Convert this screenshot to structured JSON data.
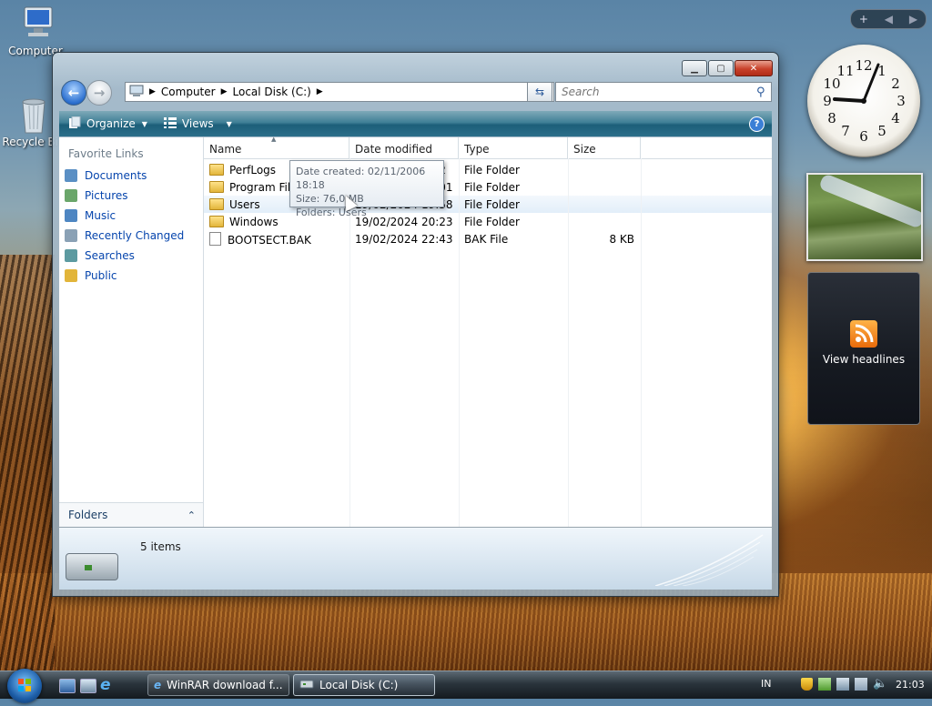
{
  "desktop": {
    "icons": [
      {
        "label": "Computer"
      },
      {
        "label": "Recycle Bin"
      }
    ]
  },
  "sidebar": {
    "controls": [
      "+",
      "◀",
      "▶"
    ],
    "clock": {
      "numbers": [
        "12",
        "1",
        "2",
        "3",
        "4",
        "5",
        "6",
        "7",
        "8",
        "9",
        "10",
        "11"
      ],
      "time": "21:03"
    },
    "feeds": {
      "label": "View headlines",
      "icon": "rss-icon"
    }
  },
  "window": {
    "title": "Local Disk (C:)",
    "caption_buttons": [
      "minimize",
      "maximize",
      "close"
    ],
    "breadcrumb": [
      "Computer",
      "Local Disk (C:)"
    ],
    "search": {
      "placeholder": "Search"
    },
    "toolbar": {
      "organize": "Organize",
      "views": "Views"
    },
    "favorite_links": {
      "heading": "Favorite Links",
      "items": [
        {
          "label": "Documents",
          "icon": "documents-icon",
          "color": "#5a8fc4"
        },
        {
          "label": "Pictures",
          "icon": "pictures-icon",
          "color": "#6aa66a"
        },
        {
          "label": "Music",
          "icon": "music-icon",
          "color": "#4e86c2"
        },
        {
          "label": "Recently Changed",
          "icon": "recently-changed-icon",
          "color": "#8aa1b5"
        },
        {
          "label": "Searches",
          "icon": "searches-icon",
          "color": "#5c9aa0"
        },
        {
          "label": "Public",
          "icon": "public-folder-icon",
          "color": "#e2b53a"
        }
      ]
    },
    "folders_label": "Folders",
    "columns": [
      "Name",
      "Date modified",
      "Type",
      "Size"
    ],
    "rows": [
      {
        "name": "PerfLogs",
        "date": "21/01/2008 9:32",
        "type": "File Folder",
        "size": "",
        "kind": "folder"
      },
      {
        "name": "Program Files",
        "date": "02/11/2006 20:01",
        "type": "File Folder",
        "size": "",
        "kind": "folder"
      },
      {
        "name": "Users",
        "date": "19/02/2024 19:58",
        "type": "File Folder",
        "size": "",
        "kind": "folder"
      },
      {
        "name": "Windows",
        "date": "19/02/2024 20:23",
        "type": "File Folder",
        "size": "",
        "kind": "folder"
      },
      {
        "name": "BOOTSECT.BAK",
        "date": "19/02/2024 22:43",
        "type": "BAK File",
        "size": "8 KB",
        "kind": "file"
      }
    ],
    "tooltip": {
      "line1": "Date created: 02/11/2006 18:18",
      "line2": "Size: 76,0 MB",
      "line3": "Folders: Users"
    },
    "status": {
      "count": "5 items"
    }
  },
  "taskbar": {
    "tasks": [
      {
        "label": "WinRAR download f...",
        "active": false
      },
      {
        "label": "Local Disk (C:)",
        "active": true
      }
    ],
    "lang": "IN",
    "clock": "21:03"
  }
}
